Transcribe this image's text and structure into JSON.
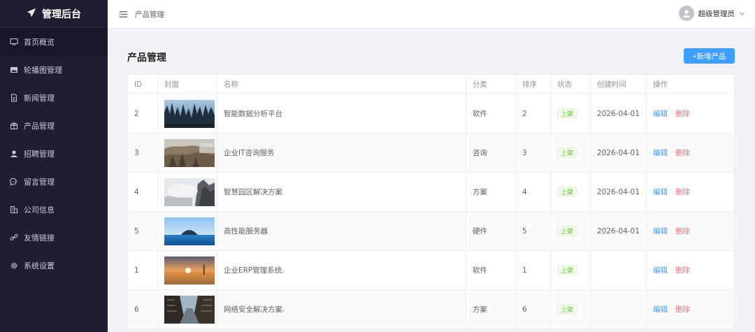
{
  "brand": {
    "title": "管理后台",
    "icon": "paper-plane-icon"
  },
  "sidebar": {
    "items": [
      {
        "label": "首页概览",
        "icon": "dashboard-icon"
      },
      {
        "label": "轮播图管理",
        "icon": "image-icon"
      },
      {
        "label": "新闻管理",
        "icon": "document-icon"
      },
      {
        "label": "产品管理",
        "icon": "box-icon"
      },
      {
        "label": "招聘管理",
        "icon": "user-icon"
      },
      {
        "label": "留言管理",
        "icon": "chat-icon"
      },
      {
        "label": "公司信息",
        "icon": "building-icon"
      },
      {
        "label": "友情链接",
        "icon": "link-icon"
      },
      {
        "label": "系统设置",
        "icon": "gear-icon"
      }
    ]
  },
  "header": {
    "breadcrumb": "产品管理",
    "user": "超级管理员"
  },
  "main": {
    "title": "产品管理",
    "add_label": "+新增产品"
  },
  "table": {
    "columns": [
      "ID",
      "封面",
      "名称",
      "分类",
      "排序",
      "状态",
      "创建时间",
      "操作"
    ],
    "rows": [
      {
        "id": "2",
        "name": "智能数据分析平台",
        "category": "软件",
        "sort": "2",
        "status": "上架",
        "created": "2026-04-01",
        "edit": "编辑",
        "delete": "删除",
        "cover": "forest"
      },
      {
        "id": "3",
        "name": "企业IT咨询服务",
        "category": "咨询",
        "sort": "3",
        "status": "上架",
        "created": "2026-04-01",
        "edit": "编辑",
        "delete": "删除",
        "cover": "hillside"
      },
      {
        "id": "4",
        "name": "智慧园区解决方案",
        "category": "方案",
        "sort": "4",
        "status": "上架",
        "created": "2026-04-01",
        "edit": "编辑",
        "delete": "删除",
        "cover": "misty-mountains"
      },
      {
        "id": "5",
        "name": "高性能服务器",
        "category": "硬件",
        "sort": "5",
        "status": "上架",
        "created": "2026-04-01",
        "edit": "编辑",
        "delete": "删除",
        "cover": "sea-island"
      },
      {
        "id": "1",
        "name": "企业ERP管理系统.",
        "category": "软件",
        "sort": "1",
        "status": "上架",
        "created": "",
        "edit": "编辑",
        "delete": "删除",
        "cover": "sunset-field"
      },
      {
        "id": "6",
        "name": "网络安全解决方案.",
        "category": "方案",
        "sort": "6",
        "status": "上架",
        "created": "",
        "edit": "编辑",
        "delete": "删除",
        "cover": "city-street"
      }
    ]
  },
  "colors": {
    "sidebar": "#1f1d31",
    "primary": "#409eff",
    "danger": "#f56c6c",
    "success": "#67c23a"
  }
}
